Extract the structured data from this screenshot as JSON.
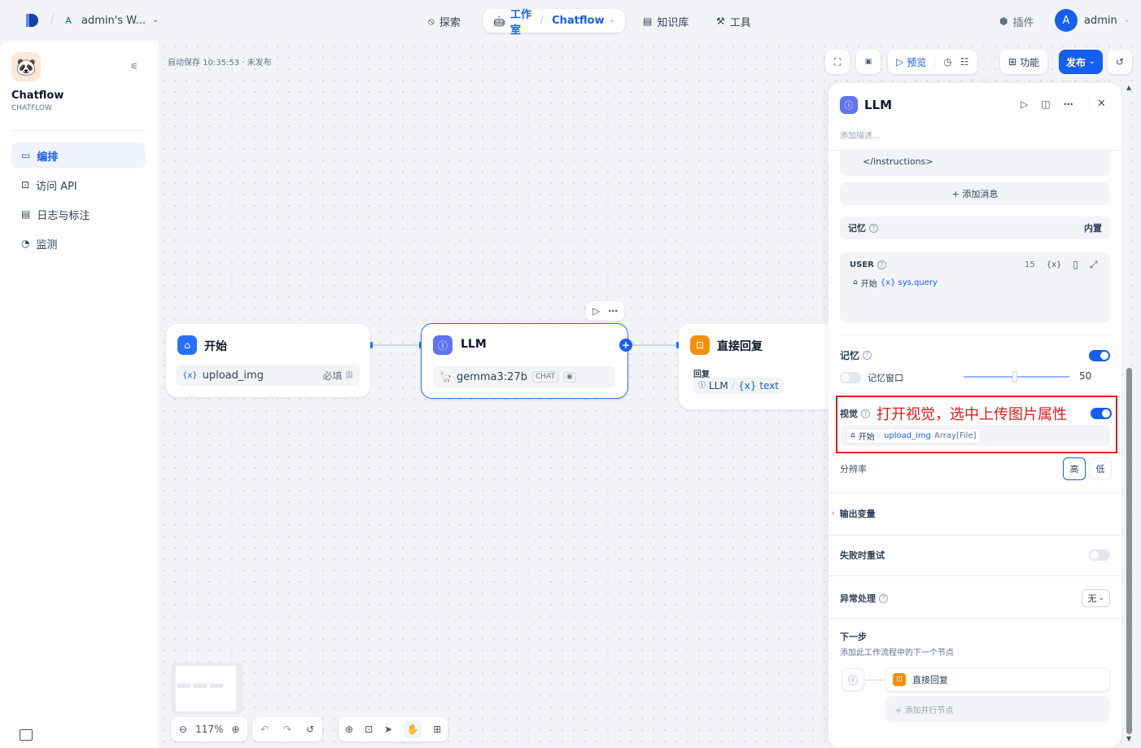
{
  "topbar": {
    "workspace_initial": "A",
    "workspace_name": "admin's W...",
    "nav": {
      "explore": "探索",
      "studio": "工作室",
      "app": "Chatflow",
      "knowledge": "知识库",
      "tools": "工具"
    },
    "plugins": "插件",
    "user_initial": "A",
    "user_name": "admin"
  },
  "sidebar": {
    "app_name": "Chatflow",
    "app_type": "CHATFLOW",
    "items": [
      {
        "label": "编排",
        "icon": "layout-icon",
        "active": true
      },
      {
        "label": "访问 API",
        "icon": "terminal-icon",
        "active": false
      },
      {
        "label": "日志与标注",
        "icon": "log-icon",
        "active": false
      },
      {
        "label": "监测",
        "icon": "monitor-icon",
        "active": false
      }
    ]
  },
  "canvas": {
    "autosave": "自动保存 10:35:53 · 未发布",
    "toolbar": {
      "preview": "预览",
      "features": "功能",
      "publish": "发布"
    },
    "zoom": "117%",
    "nodes": {
      "start": {
        "title": "开始",
        "var_prefix": "{x}",
        "var_name": "upload_img",
        "required": "必填"
      },
      "llm": {
        "title": "LLM",
        "model": "gemma3:27b",
        "mode": "CHAT"
      },
      "answer": {
        "title": "直接回复",
        "label": "回复",
        "src_node": "LLM",
        "src_var": "{x} text"
      }
    }
  },
  "panel": {
    "title": "LLM",
    "desc_placeholder": "添加描述...",
    "instructions_tail": "</instructions>",
    "add_message": "+ 添加消息",
    "memory_header": "记忆",
    "builtin": "内置",
    "user_block": {
      "label": "USER",
      "count": "15",
      "var_icon": "{x}",
      "src_node": "开始",
      "src_var": "{x} sys.query"
    },
    "memory": {
      "label": "记忆",
      "window_label": "记忆窗口",
      "window_value": "50",
      "window_fraction": 0.5
    },
    "vision": {
      "label": "视觉",
      "annotation": "打开视觉，选中上传图片属性",
      "src_node": "开始",
      "src_var": "upload_img",
      "src_type": "Array[File]"
    },
    "resolution": {
      "label": "分辨率",
      "high": "高",
      "low": "低"
    },
    "output_vars": "输出变量",
    "retry": "失败时重试",
    "error_handling": {
      "label": "异常处理",
      "value": "无"
    },
    "next_step": {
      "title": "下一步",
      "desc": "添加此工作流程中的下一个节点",
      "next_node": "直接回复",
      "add_parallel": "+ 添加并行节点"
    }
  },
  "colors": {
    "primary": "#155eef",
    "llm_icon": "#6172f3",
    "start_icon": "#2970ff",
    "answer_icon": "#f79009",
    "annotation_red": "#e01b1b"
  }
}
